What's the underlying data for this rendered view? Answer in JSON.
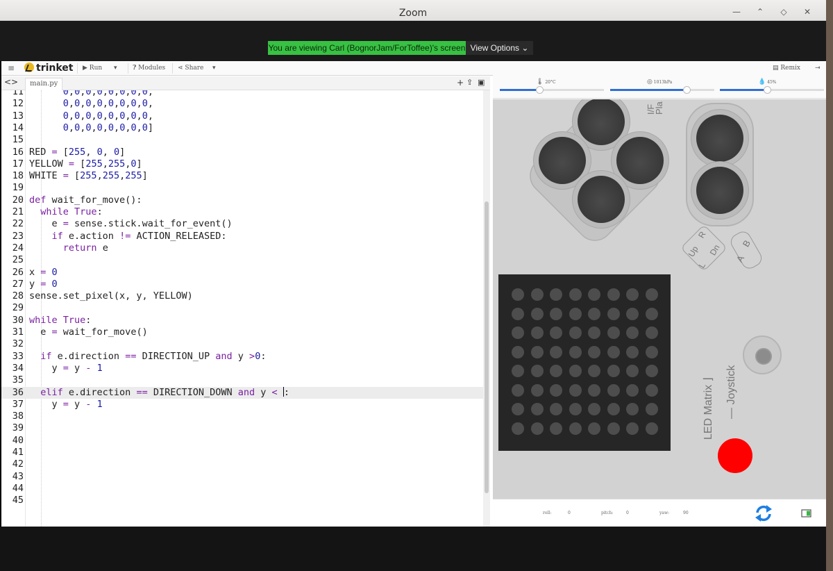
{
  "zoom": {
    "title": "Zoom",
    "viewing_text": "You are viewing Carl (BognorJam/ForToffee)'s screen",
    "view_options": "View Options",
    "window_controls": [
      "minimize-icon",
      "maximize-icon",
      "restore-icon",
      "close-icon"
    ]
  },
  "toolbar": {
    "menu_icon": "≡",
    "logo": "trinket",
    "run": "Run",
    "modules": "Modules",
    "share": "Share",
    "remix": "Remix"
  },
  "editor": {
    "file_tab": "main.py",
    "lines": [
      {
        "n": "11",
        "code": "      0,0,0,0,0,0,0,0,"
      },
      {
        "n": "12",
        "code": "      0,0,0,0,0,0,0,0,"
      },
      {
        "n": "13",
        "code": "      0,0,0,0,0,0,0,0,"
      },
      {
        "n": "14",
        "code": "      0,0,0,0,0,0,0,0]"
      },
      {
        "n": "15",
        "code": ""
      },
      {
        "n": "16",
        "code": "RED = [255, 0, 0]"
      },
      {
        "n": "17",
        "code": "YELLOW = [255,255,0]"
      },
      {
        "n": "18",
        "code": "WHITE = [255,255,255]"
      },
      {
        "n": "19",
        "code": ""
      },
      {
        "n": "20",
        "code": "def wait_for_move():"
      },
      {
        "n": "21",
        "code": "  while True:"
      },
      {
        "n": "22",
        "code": "    e = sense.stick.wait_for_event()"
      },
      {
        "n": "23",
        "code": "    if e.action != ACTION_RELEASED:"
      },
      {
        "n": "24",
        "code": "      return e"
      },
      {
        "n": "25",
        "code": ""
      },
      {
        "n": "26",
        "code": "x = 0"
      },
      {
        "n": "27",
        "code": "y = 0"
      },
      {
        "n": "28",
        "code": "sense.set_pixel(x, y, YELLOW)"
      },
      {
        "n": "29",
        "code": ""
      },
      {
        "n": "30",
        "code": "while True:"
      },
      {
        "n": "31",
        "code": "  e = wait_for_move()"
      },
      {
        "n": "32",
        "code": ""
      },
      {
        "n": "33",
        "code": "  if e.direction == DIRECTION_UP and y >0:"
      },
      {
        "n": "34",
        "code": "    y = y - 1"
      },
      {
        "n": "35",
        "code": ""
      },
      {
        "n": "36",
        "code": "  elif e.direction == DIRECTION_DOWN and y < :"
      },
      {
        "n": "37",
        "code": "    y = y - 1"
      },
      {
        "n": "38",
        "code": ""
      },
      {
        "n": "39",
        "code": ""
      },
      {
        "n": "40",
        "code": ""
      },
      {
        "n": "41",
        "code": ""
      },
      {
        "n": "42",
        "code": ""
      },
      {
        "n": "43",
        "code": ""
      },
      {
        "n": "44",
        "code": ""
      },
      {
        "n": "45",
        "code": ""
      }
    ],
    "active_line": "36"
  },
  "sensehat": {
    "temperature": "20°C",
    "temperature_level": 0.38,
    "pressure": "1013hPa",
    "pressure_level": 0.73,
    "humidity": "45%",
    "humidity_level": 0.45,
    "board_labels": {
      "top_cut": "I/F\nPla",
      "led_matrix": "LED Matrix ⌋",
      "joystick": "— Joystick",
      "up": "Up",
      "r": "R",
      "l": "L",
      "dn": "Dn",
      "a": "A",
      "b": "B"
    },
    "orientation": {
      "roll_label": "roll:",
      "roll": "0",
      "pitch_label": "pitch:",
      "pitch": "0",
      "yaw_label": "yaw:",
      "yaw": "90"
    },
    "colors": {
      "accent": "#2f6fd6",
      "led_on": "#ff0000",
      "matrix": "#262626"
    }
  }
}
